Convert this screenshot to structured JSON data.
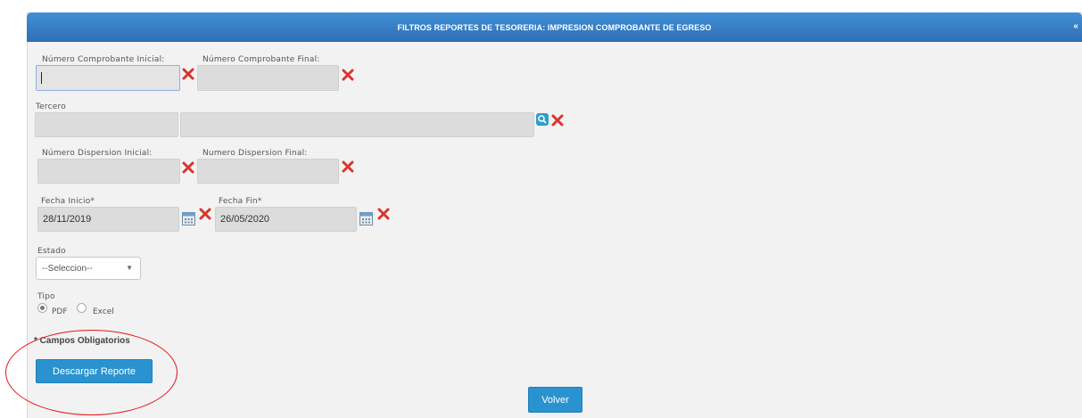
{
  "header": {
    "title": "FILTROS REPORTES DE TESORERIA: IMPRESION COMPROBANTE DE EGRESO",
    "collapse_symbol": "«"
  },
  "comprobante": {
    "inicial_label": "Número Comprobante Inicial:",
    "final_label": "Número Comprobante Final:",
    "inicial_value": "",
    "final_value": ""
  },
  "tercero": {
    "label": "Tercero",
    "code_value": "",
    "name_value": ""
  },
  "dispersion": {
    "inicial_label": "Número Dispersion Inicial:",
    "final_label": "Numero Dispersion Final:",
    "inicial_value": "",
    "final_value": ""
  },
  "fechas": {
    "inicio_label": "Fecha Inicio*",
    "inicio_value": "28/11/2019",
    "fin_label": "Fecha Fin*",
    "fin_value": "26/05/2020"
  },
  "estado": {
    "label": "Estado",
    "selected": "--Seleccion--"
  },
  "tipo": {
    "label": "Tipo",
    "options": [
      "PDF",
      "Excel"
    ],
    "selected": "PDF"
  },
  "note": "* Campos Obligatorios",
  "buttons": {
    "descargar": "Descargar Reporte",
    "volver": "Volver"
  },
  "colors": {
    "header": "#2f6fb3",
    "button": "#2a93cf",
    "clear_icon": "#d9342b",
    "annotation": "#e01818"
  },
  "icons": [
    "clear-icon",
    "calendar-icon",
    "search-icon"
  ]
}
